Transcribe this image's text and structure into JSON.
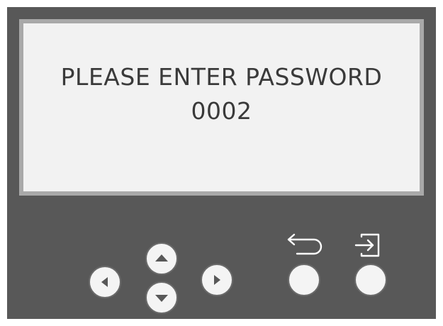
{
  "display": {
    "line1": "PLEASE ENTER PASSWORD",
    "line2": "0002"
  },
  "buttons": {
    "left": {
      "icon": "arrow-left-icon"
    },
    "up": {
      "icon": "arrow-up-icon"
    },
    "down": {
      "icon": "arrow-down-icon"
    },
    "right": {
      "icon": "arrow-right-icon"
    },
    "back": {
      "icon": "back-arrow-icon"
    },
    "enter": {
      "icon": "enter-icon"
    }
  },
  "colors": {
    "panel": "#585858",
    "screen_frame": "#a9a9a9",
    "screen": "#f2f2f2",
    "text": "#3a3a3a",
    "button_face": "#f4f4f4",
    "arrow": "#585858"
  }
}
